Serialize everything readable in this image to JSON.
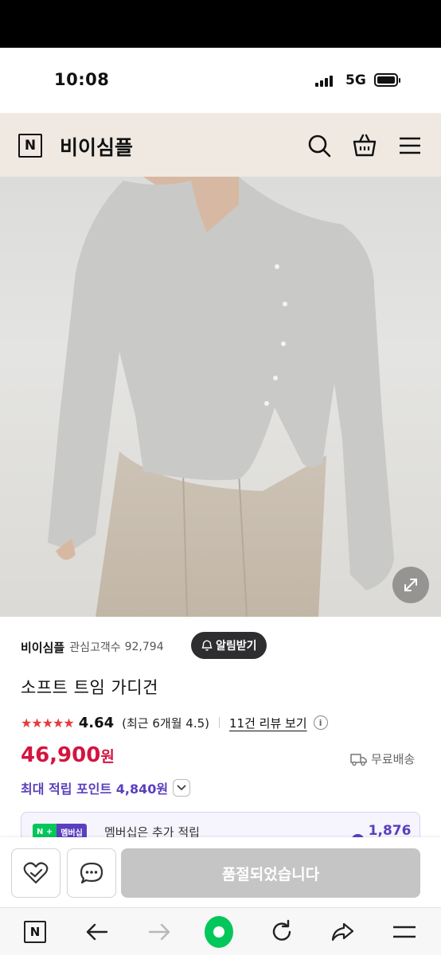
{
  "status_bar": {
    "time": "10:08",
    "network": "5G"
  },
  "header": {
    "logo_letter": "N",
    "store_name": "비이심플"
  },
  "store": {
    "name": "비이심플",
    "followers_label": "관심고객수",
    "followers_count": "92,794",
    "alarm_button": "알림받기"
  },
  "product": {
    "name": "소프트 트임 가디건",
    "rating": "4.64",
    "rating_recent": "(최근 6개월 4.5)",
    "review_link": "11건 리뷰 보기",
    "price": "46,900",
    "price_unit": "원",
    "shipping": "무료배송",
    "points_text": "최대 적립 포인트 4,840원"
  },
  "membership": {
    "badge_n": "N +",
    "badge_label": "멤버십",
    "text": "멤버십은 추가 적립",
    "points": "1,876원"
  },
  "actions": {
    "soldout_label": "품절되었습니다"
  },
  "browser": {
    "logo_letter": "N"
  },
  "colors": {
    "price": "#d4143f",
    "points": "#5a3fbf",
    "stars": "#e63a3e",
    "naver_green": "#03c75a"
  }
}
